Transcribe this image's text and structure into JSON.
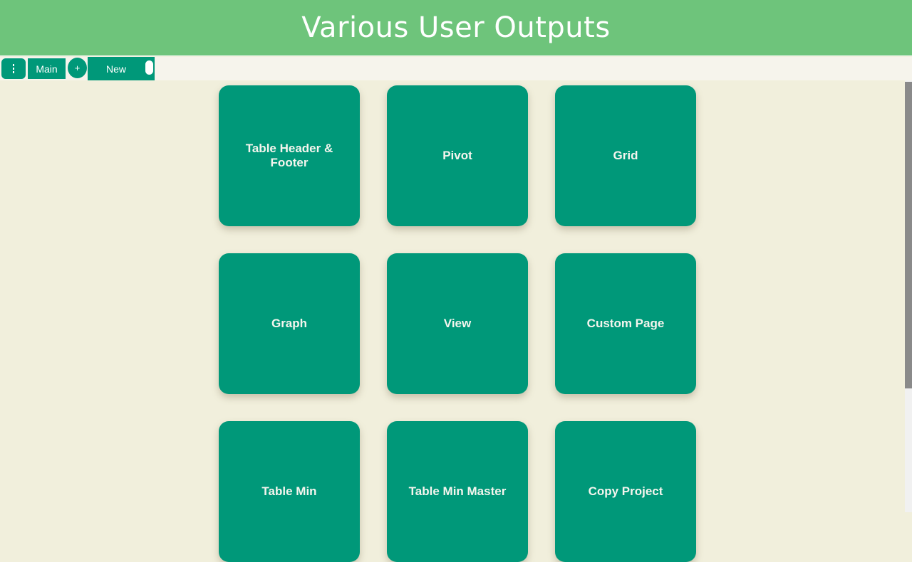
{
  "header": {
    "title": "Various User Outputs"
  },
  "tabbar": {
    "menu_icon": "vertical-dots-icon",
    "main_label": "Main",
    "add_label": "+",
    "new_label": "New"
  },
  "tiles": [
    {
      "label": "Table Header & Footer"
    },
    {
      "label": "Pivot"
    },
    {
      "label": "Grid"
    },
    {
      "label": "Graph"
    },
    {
      "label": "View"
    },
    {
      "label": "Custom Page"
    },
    {
      "label": "Table Min"
    },
    {
      "label": "Table Min Master"
    },
    {
      "label": "Copy Project"
    }
  ],
  "colors": {
    "header_bg": "#6ec47b",
    "tile_bg": "#009879",
    "page_bg": "#f1efdc"
  }
}
